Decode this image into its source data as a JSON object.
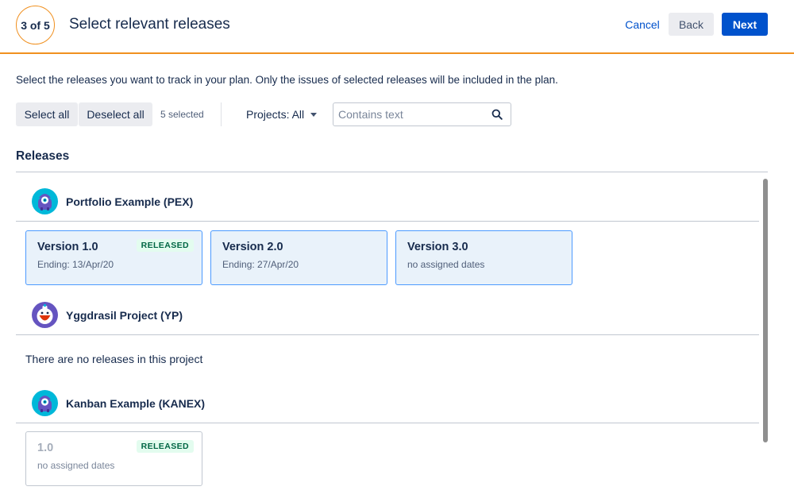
{
  "header": {
    "step": "3 of 5",
    "title": "Select relevant releases",
    "cancel_label": "Cancel",
    "back_label": "Back",
    "next_label": "Next",
    "accent_color": "#f0901f",
    "primary_color": "#0052cc"
  },
  "intro_text": "Select the releases you want to track in your plan. Only the issues of selected releases will be included in the plan.",
  "toolbar": {
    "select_all_label": "Select all",
    "deselect_all_label": "Deselect all",
    "selected_count": "5 selected",
    "projects_filter_label": "Projects: All",
    "search_placeholder": "Contains text",
    "search_value": ""
  },
  "releases_heading": "Releases",
  "projects": [
    {
      "name": "Portfolio Example (PEX)",
      "avatar": "portfolio-project-icon",
      "releases": [
        {
          "name": "Version 1.0",
          "date": "Ending: 13/Apr/20",
          "badge": "RELEASED",
          "selected": true
        },
        {
          "name": "Version 2.0",
          "date": "Ending: 27/Apr/20",
          "badge": "",
          "selected": true
        },
        {
          "name": "Version 3.0",
          "date": "no assigned dates",
          "badge": "",
          "selected": true
        }
      ]
    },
    {
      "name": "Yggdrasil Project (YP)",
      "avatar": "yggdrasil-project-icon",
      "empty_message": "There are no releases in this project",
      "releases": []
    },
    {
      "name": "Kanban Example (KANEX)",
      "avatar": "kanban-project-icon",
      "releases": [
        {
          "name": "1.0",
          "date": "no assigned dates",
          "badge": "RELEASED",
          "selected": false
        }
      ]
    }
  ]
}
